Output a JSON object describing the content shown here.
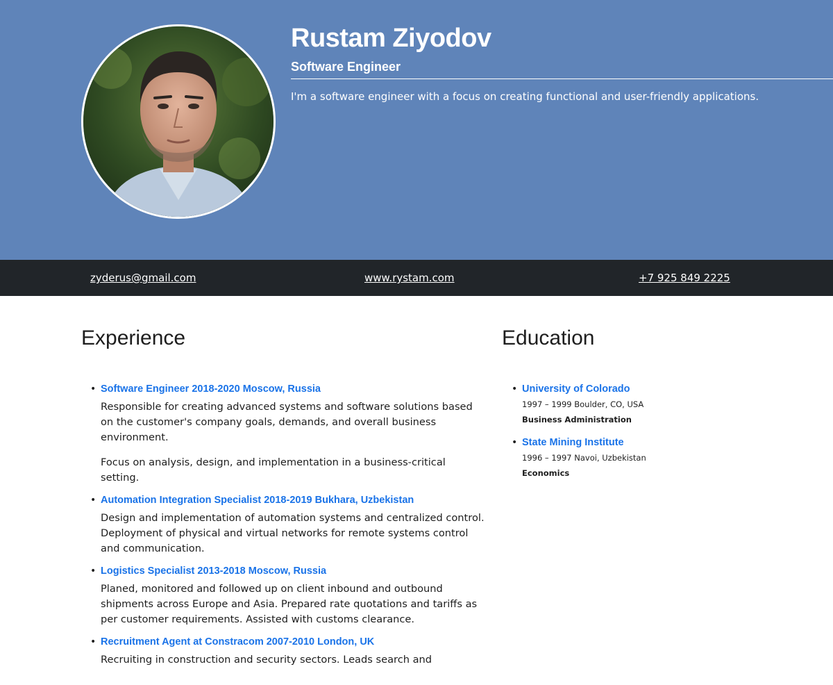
{
  "profile": {
    "name": "Rustam Ziyodov",
    "title": "Software Engineer",
    "summary": "I'm a software engineer with a focus on creating functional and user-friendly applications.",
    "photo_alt": "Portrait photo"
  },
  "contact": {
    "email": "zyderus@gmail.com",
    "website": "www.rystam.com",
    "phone": "+7 925 849 2225"
  },
  "colors": {
    "header_bg": "#5f84b9",
    "contact_bar_bg": "#212529",
    "link": "#1a73e8"
  },
  "experience": {
    "heading": "Experience",
    "items": [
      {
        "title": "Software Engineer 2018-2020 Moscow, Russia",
        "paragraphs": [
          "Responsible for creating advanced systems and software solutions based on the customer's company goals, demands, and overall business environment.",
          "Focus on analysis, design, and implementation in a business-critical setting."
        ]
      },
      {
        "title": "Automation Integration Specialist 2018-2019 Bukhara, Uzbekistan",
        "paragraphs": [
          "Design and implementation of automation systems and centralized control. Deployment of physical and virtual networks for remote systems control and communication."
        ]
      },
      {
        "title": "Logistics Specialist 2013-2018 Moscow, Russia",
        "paragraphs": [
          "Planed, monitored and followed up on client inbound and outbound shipments across Europe and Asia. Prepared rate quotations and tariffs as per customer requirements. Assisted with customs clearance."
        ]
      },
      {
        "title": "Recruitment Agent at Constracom 2007-2010 London, UK",
        "paragraphs": [
          "Recruiting in construction and security sectors. Leads search and"
        ]
      }
    ]
  },
  "education": {
    "heading": "Education",
    "items": [
      {
        "school": "University of Colorado",
        "meta": "1997 – 1999 Boulder, CO, USA",
        "degree": "Business Administration"
      },
      {
        "school": "State Mining Institute",
        "meta": "1996 – 1997 Navoi, Uzbekistan",
        "degree": "Economics"
      }
    ]
  }
}
